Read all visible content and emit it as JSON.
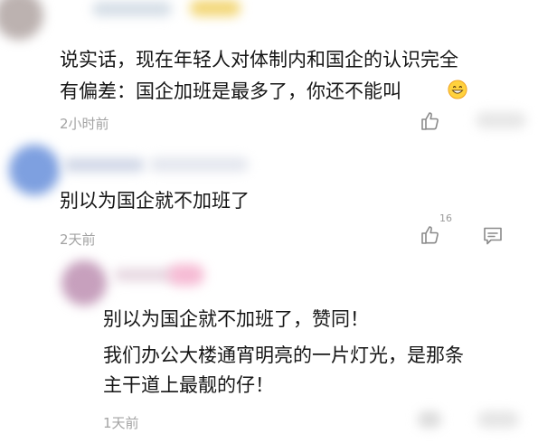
{
  "comments": [
    {
      "text_lines": [
        "说实话，现在年轻人对体制内和国企的认识完全",
        "有偏差：国企加班是最多了，你还不能叫"
      ],
      "emoji": "grinning-face",
      "time": "2小时前"
    },
    {
      "text_lines": [
        "别以为国企就不加班了"
      ],
      "time": "2天前",
      "like_count": "16"
    },
    {
      "text_lines": [
        "别以为国企就不加班了，赞同！",
        "我们办公大楼通宵明亮的一片灯光，是那条",
        "主干道上最靓的仔！"
      ],
      "time": "1天前"
    }
  ],
  "icons": {
    "like": "thumbs-up-icon",
    "reply": "comment-icon"
  }
}
